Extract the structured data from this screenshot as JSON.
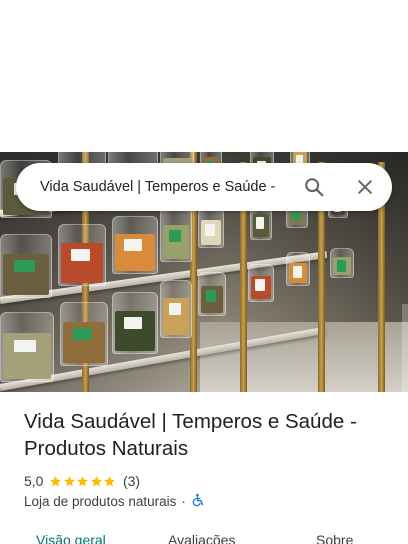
{
  "search": {
    "query": "Vida Saudável | Temperos e Saúde -",
    "search_icon": "search-icon",
    "close_icon": "close-icon"
  },
  "place": {
    "title": "Vida Saudável | Temperos e Saúde - Produtos Naturais",
    "rating": "5,0",
    "stars": 5,
    "review_count": "(3)",
    "category": "Loja de produtos naturais",
    "separator": "·",
    "accessibility_icon": "wheelchair-icon"
  },
  "tabs": [
    {
      "label": "Visão geral",
      "active": true
    },
    {
      "label": "Avaliações",
      "active": false
    },
    {
      "label": "Sobre",
      "active": false
    }
  ],
  "colors": {
    "star": "#fbbc04",
    "accent": "#00796b",
    "accessibility": "#1a73e8"
  }
}
